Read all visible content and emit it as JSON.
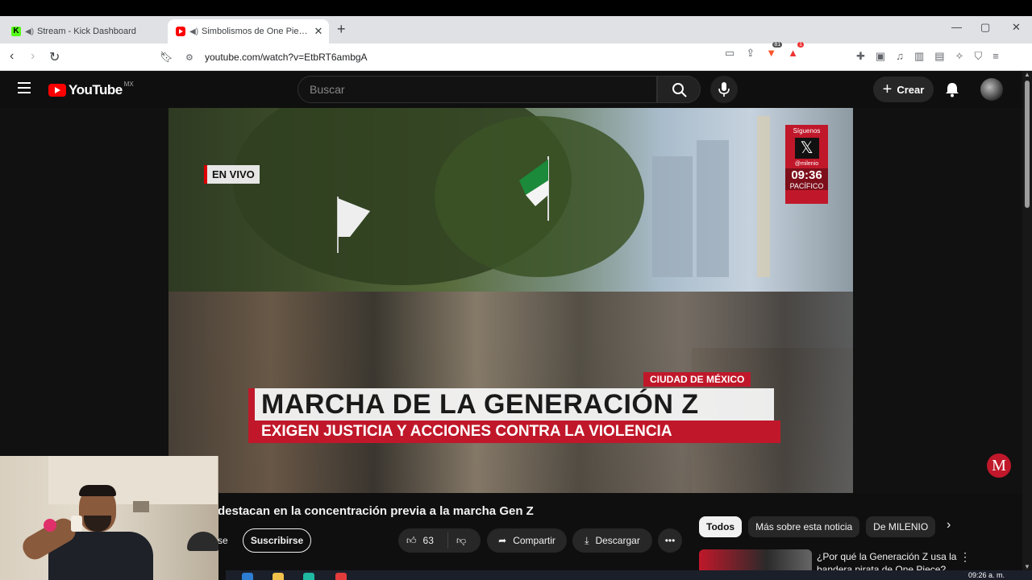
{
  "browser": {
    "tabs": [
      {
        "title": "Stream - Kick Dashboard",
        "active": false,
        "favicon": "kick-icon"
      },
      {
        "title": "Simbolismos de One Piece de",
        "active": true,
        "favicon": "youtube-icon"
      }
    ],
    "url": "youtube.com/watch?v=EtbRT6ambgA",
    "brave_badge": "81",
    "alert_badge": "1"
  },
  "youtube": {
    "logo_text": "YouTube",
    "region": "MX",
    "search_placeholder": "Buscar",
    "create_label": "Crear"
  },
  "video_overlay": {
    "live_label": "EN VIVO",
    "follow_label": "Síguenos",
    "handle": "@milenio",
    "time": "09:36",
    "zone": "PACÍFICO",
    "city": "CIUDAD DE MÉXICO",
    "headline": "MARCHA DE LA GENERACIÓN Z",
    "subheadline": "EXIGEN JUSTICIA Y ACCIONES CONTRA LA VIOLENCIA",
    "channel_logo": "M"
  },
  "video_info": {
    "title_partial": "destacan en la concentración previa a la marcha Gen Z",
    "cut_label": "se",
    "subscribe_label": "Suscribirse",
    "likes": "63",
    "share_label": "Compartir",
    "download_label": "Descargar"
  },
  "recommendations": {
    "chips": [
      "Todos",
      "Más sobre esta noticia",
      "De MILENIO"
    ],
    "first_item_title": "¿Por qué la Generación Z usa la bandera pirata de One Piece?"
  },
  "taskbar": {
    "clock": "09:26 a. m."
  },
  "colors": {
    "yt_red": "#ff0000",
    "milenio_red": "#c0182a",
    "bg_dark": "#0f0f0f"
  }
}
